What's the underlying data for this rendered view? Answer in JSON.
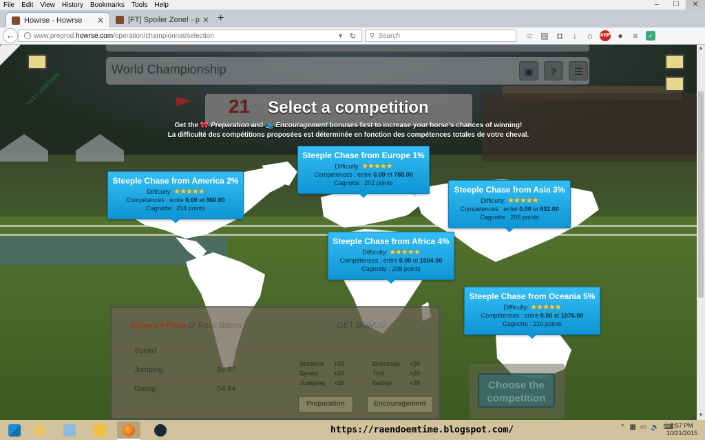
{
  "browser": {
    "menu": [
      "File",
      "Edit",
      "View",
      "History",
      "Bookmarks",
      "Tools",
      "Help"
    ],
    "window_controls": {
      "minimize": "–",
      "maximize": "☐",
      "close": "✕"
    },
    "tabs": [
      {
        "title": "Howrse - Howrse",
        "active": true
      },
      {
        "title": "[FT] Spoiler Zone! - page 1...",
        "active": false
      }
    ],
    "new_tab": "+",
    "url_prefix": "www.preprod.",
    "url_domain": "howrse.com",
    "url_path": "/operation/championnat/selection",
    "search_placeholder": "Search",
    "abp_label": "ABP"
  },
  "game": {
    "ribbon": "TEST VERSION",
    "championship_title": "World Championship",
    "race_number": "21",
    "race_name": "Steeple Chase",
    "heading": "Select a competition",
    "intro_pre": "Get the ",
    "intro_prep": "Preparation",
    "intro_mid": " and ",
    "intro_enc": "Encouragement",
    "intro_post": " bonuses first to increase your horse's chances of winning!",
    "intro_fr": "La difficulté des compétitions proposées est déterminée en fonction des compétences totales de votre cheval.",
    "stats_panel": {
      "header_a": "Olivers",
      "header_b": "Pride",
      "header_c": " of Rock Bitters",
      "rows": [
        {
          "label": "Speed",
          "value": ""
        },
        {
          "label": "Jumping",
          "value": "39.97"
        },
        {
          "label": "Gallop",
          "value": "54.94"
        }
      ],
      "get_bonus": "GET BONUS",
      "skills": [
        {
          "name": "Stamina",
          "value": "+20"
        },
        {
          "name": "Speed",
          "value": "+20"
        },
        {
          "name": "Jumping",
          "value": "+20"
        },
        {
          "name": "Dressage",
          "value": "+20"
        },
        {
          "name": "Trot",
          "value": "+20"
        },
        {
          "name": "Gallop",
          "value": "+20"
        }
      ],
      "btn_preparation": "Preparation",
      "btn_encouragement": "Encouragement"
    },
    "choose_button": "Choose the competition",
    "difficulty_label": "Difficulty:",
    "difficulty_rating": 5,
    "competitions": [
      {
        "title": "Steeple Chase from America 2%",
        "min": "0.00",
        "max": "860.00",
        "jackpot": "204 points"
      },
      {
        "title": "Steeple Chase from Europe 1%",
        "min": "0.00",
        "max": "788.00",
        "jackpot": "202 points"
      },
      {
        "title": "Steeple Chase from Asia 3%",
        "min": "0.00",
        "max": "932.00",
        "jackpot": "206 points"
      },
      {
        "title": "Steeple Chase from Africa 4%",
        "min": "0.00",
        "max": "1004.00",
        "jackpot": "208 points"
      },
      {
        "title": "Steeple Chase from Oceania 5%",
        "min": "0.00",
        "max": "1076.00",
        "jackpot": "210 points"
      }
    ],
    "comp_label": "Compétences : entre ",
    "comp_and": " et ",
    "jackpot_label": "Cagnotte : "
  },
  "taskbar": {
    "blog_url": "https://raendoemtime.blogspot.com/",
    "time": "3:57 PM",
    "date": "10/21/2015"
  },
  "colors": {
    "tooltip_blue": "#1aa6e6",
    "star_gold": "#ffd23a",
    "taskbar": "#d2c39c"
  }
}
